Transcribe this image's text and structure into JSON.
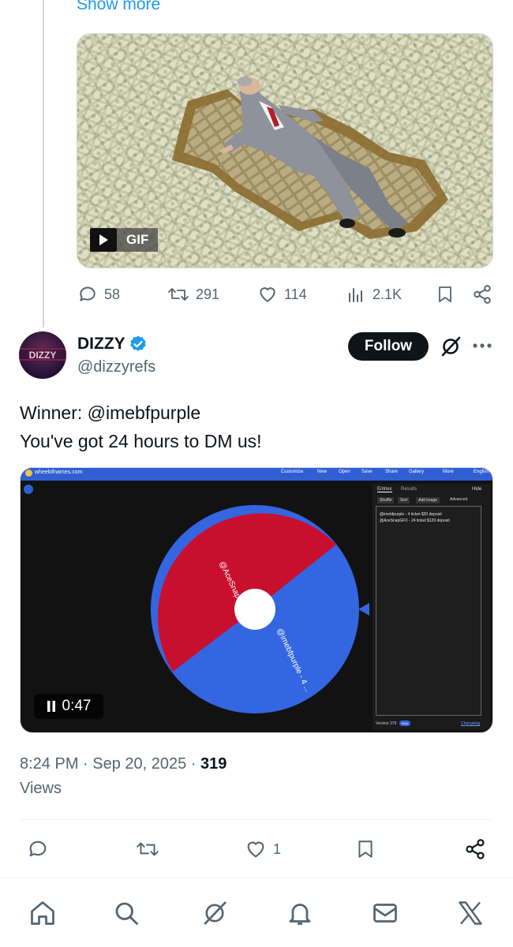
{
  "prev_tweet": {
    "show_more": "Show more",
    "gif_label": "GIF",
    "actions": {
      "replies": "58",
      "retweets": "291",
      "likes": "114",
      "views": "2.1K"
    }
  },
  "tweet": {
    "avatar_text": "DIZZY",
    "display_name": "DIZZY",
    "handle": "@dizzyrefs",
    "follow_label": "Follow",
    "text_line1": "Winner: @imebfpurple",
    "text_line2": "You've got 24 hours to DM us!",
    "video": {
      "duration": "0:47",
      "site": "wheelofnames.com",
      "toolbar": [
        "Customize",
        "New",
        "Open",
        "Save",
        "Share",
        "Gallery",
        "More",
        "English"
      ],
      "tabs": [
        "Entries",
        "Results"
      ],
      "hide_label": "Hide",
      "buttons": [
        "Shuffle",
        "Sort",
        "Add image"
      ],
      "advanced_label": "Advanced",
      "entries": [
        "@imebfpurple - 4 ticket $20 deposit",
        "@AceSnapGFX - 24 ticket $120 deposit"
      ],
      "wheel_labels": [
        "@AceSnapGFX - 24",
        "@imebfpurple - 4 ..."
      ],
      "version": "Version 379",
      "new_badge": "New",
      "changelog": "Changelog",
      "colors": {
        "red": "#c8102e",
        "blue": "#3366e0"
      }
    },
    "time": "8:24 PM",
    "date": "Sep 20, 2025",
    "views_count": "319",
    "views_label": "Views",
    "likes": "1"
  },
  "nav": [
    "home-icon",
    "search-icon",
    "grok-icon",
    "notifications-icon",
    "messages-icon",
    "x-icon"
  ]
}
